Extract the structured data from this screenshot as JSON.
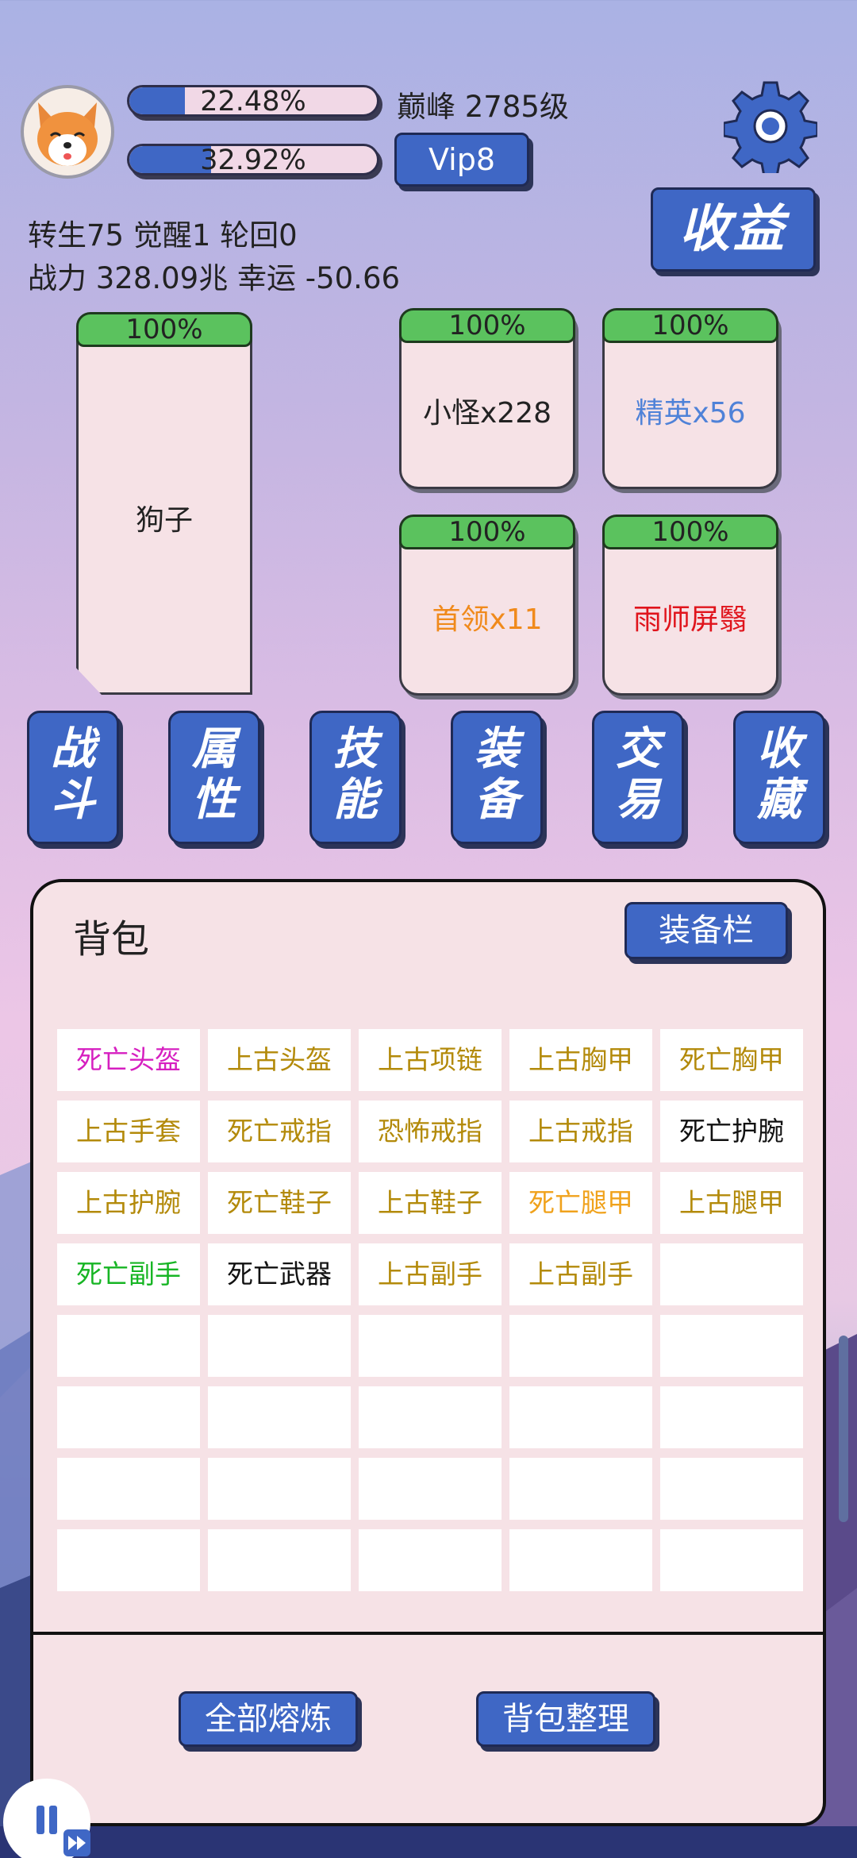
{
  "header": {
    "exp_bar_1": {
      "text": "22.48%",
      "fill": 0.2248
    },
    "exp_bar_2": {
      "text": "32.92%",
      "fill": 0.3292
    },
    "level": "巅峰 2785级",
    "vip": "Vip8",
    "income_button": "收益",
    "stats_line1": "转生75 觉醒1 轮回0",
    "stats_line2": "战力 328.09兆  幸运 -50.66"
  },
  "cards": {
    "player": {
      "percent": "100%",
      "name": "狗子"
    },
    "minion": {
      "percent": "100%",
      "name": "小怪x228",
      "color": "#222222"
    },
    "elite": {
      "percent": "100%",
      "name": "精英x56",
      "color": "#4f82d8"
    },
    "leader": {
      "percent": "100%",
      "name": "首领x11",
      "color": "#f08a1c"
    },
    "boss": {
      "percent": "100%",
      "name": "雨师屏翳",
      "color": "#e0141c"
    }
  },
  "nav": [
    {
      "line1": "战",
      "line2": "斗"
    },
    {
      "line1": "属",
      "line2": "性"
    },
    {
      "line1": "技",
      "line2": "能"
    },
    {
      "line1": "装",
      "line2": "备"
    },
    {
      "line1": "交",
      "line2": "易"
    },
    {
      "line1": "收",
      "line2": "藏"
    }
  ],
  "bag": {
    "title": "背包",
    "equip_button": "装备栏",
    "items": [
      {
        "name": "死亡头盔",
        "color": "#d61fc0"
      },
      {
        "name": "上古头盔",
        "color": "#b38a0a"
      },
      {
        "name": "上古项链",
        "color": "#b38a0a"
      },
      {
        "name": "上古胸甲",
        "color": "#b38a0a"
      },
      {
        "name": "死亡胸甲",
        "color": "#b38a0a"
      },
      {
        "name": "上古手套",
        "color": "#b38a0a"
      },
      {
        "name": "死亡戒指",
        "color": "#b38a0a"
      },
      {
        "name": "恐怖戒指",
        "color": "#b38a0a"
      },
      {
        "name": "上古戒指",
        "color": "#b38a0a"
      },
      {
        "name": "死亡护腕",
        "color": "#111111"
      },
      {
        "name": "上古护腕",
        "color": "#b38a0a"
      },
      {
        "name": "死亡鞋子",
        "color": "#b38a0a"
      },
      {
        "name": "上古鞋子",
        "color": "#b38a0a"
      },
      {
        "name": "死亡腿甲",
        "color": "#f0a21c"
      },
      {
        "name": "上古腿甲",
        "color": "#b38a0a"
      },
      {
        "name": "死亡副手",
        "color": "#17b524"
      },
      {
        "name": "死亡武器",
        "color": "#111111"
      },
      {
        "name": "上古副手",
        "color": "#b38a0a"
      },
      {
        "name": "上古副手",
        "color": "#b38a0a"
      },
      {
        "name": "",
        "color": "#111111"
      },
      {
        "name": "",
        "color": "#111111"
      },
      {
        "name": "",
        "color": "#111111"
      },
      {
        "name": "",
        "color": "#111111"
      },
      {
        "name": "",
        "color": "#111111"
      },
      {
        "name": "",
        "color": "#111111"
      },
      {
        "name": "",
        "color": "#111111"
      },
      {
        "name": "",
        "color": "#111111"
      },
      {
        "name": "",
        "color": "#111111"
      },
      {
        "name": "",
        "color": "#111111"
      },
      {
        "name": "",
        "color": "#111111"
      },
      {
        "name": "",
        "color": "#111111"
      },
      {
        "name": "",
        "color": "#111111"
      },
      {
        "name": "",
        "color": "#111111"
      },
      {
        "name": "",
        "color": "#111111"
      },
      {
        "name": "",
        "color": "#111111"
      },
      {
        "name": "",
        "color": "#111111"
      },
      {
        "name": "",
        "color": "#111111"
      },
      {
        "name": "",
        "color": "#111111"
      },
      {
        "name": "",
        "color": "#111111"
      },
      {
        "name": "",
        "color": "#111111"
      }
    ],
    "smelt_all_button": "全部熔炼",
    "sort_button": "背包整理"
  },
  "colors": {
    "accent_blue": "#3f67c5",
    "hp_green": "#5bc25e",
    "card_bg": "#f6e2e6"
  },
  "icons": {
    "settings": "gear-icon",
    "avatar": "corgi-avatar",
    "pause": "pause-icon",
    "speed": "fast-forward-icon"
  }
}
